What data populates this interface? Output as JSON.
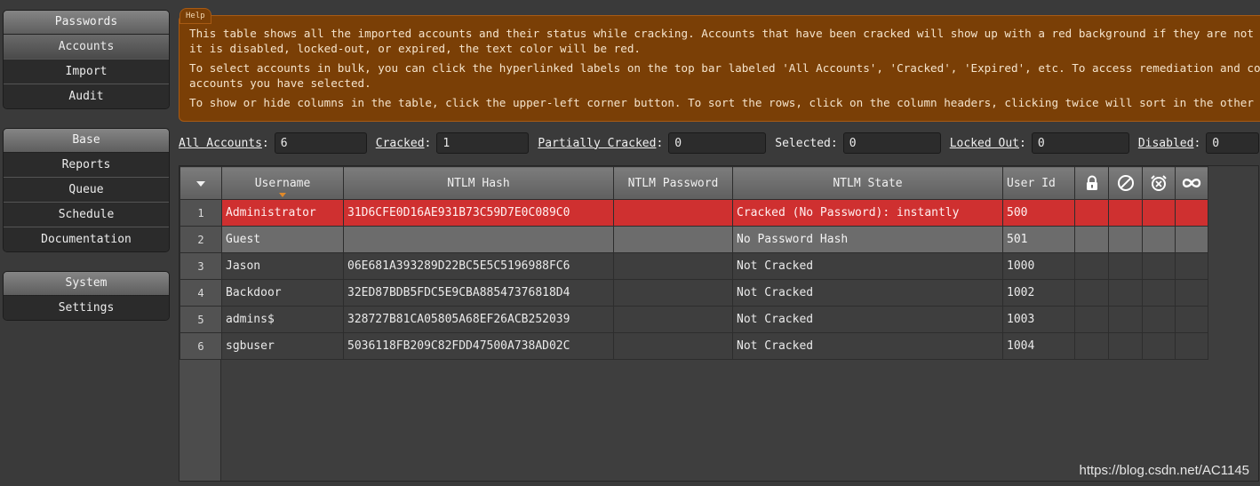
{
  "sidebar": {
    "groups": [
      {
        "header": "Passwords",
        "items": [
          "Accounts",
          "Import",
          "Audit"
        ]
      },
      {
        "header": "Base",
        "items": [
          "Reports",
          "Queue",
          "Schedule",
          "Documentation"
        ]
      },
      {
        "header": "System",
        "items": [
          "Settings"
        ]
      }
    ],
    "selected": "Accounts"
  },
  "help": {
    "tab": "Help",
    "line1": "This table shows all the imported accounts and their status while cracking. Accounts that have been cracked will show up with a red background if they are not lo",
    "line2": "it is disabled, locked-out, or expired, the text color will be red.",
    "line3": "To select accounts in bulk, you can click the hyperlinked labels on the top bar labeled 'All Accounts', 'Cracked', 'Expired', etc. To access remediation and copy",
    "line4": "accounts you have selected.",
    "line5": "To show or hide columns in the table, click the upper-left corner button. To sort the rows, click on the column headers, clicking twice will sort in the other di"
  },
  "filters": {
    "all_accounts": {
      "label": "All Accounts",
      "value": "6"
    },
    "cracked": {
      "label": "Cracked",
      "value": "1"
    },
    "partially_cracked": {
      "label": "Partially Cracked",
      "value": "0"
    },
    "selected": {
      "label": "Selected",
      "value": "0"
    },
    "locked_out": {
      "label": "Locked Out",
      "value": "0"
    },
    "disabled": {
      "label": "Disabled",
      "value": "0"
    }
  },
  "table": {
    "columns": {
      "username": "Username",
      "ntlm_hash": "NTLM Hash",
      "ntlm_password": "NTLM Password",
      "ntlm_state": "NTLM State",
      "user_id": "User Id"
    },
    "icon_columns": [
      "lock-icon",
      "disabled-icon",
      "expired-alarm-icon",
      "never-expire-icon"
    ],
    "rows": [
      {
        "num": "1",
        "username": "Administrator",
        "hash": "31D6CFE0D16AE931B73C59D7E0C089C0",
        "password": "",
        "state": "Cracked (No Password): instantly",
        "uid": "500",
        "style": "cracked"
      },
      {
        "num": "2",
        "username": "Guest",
        "hash": "",
        "password": "",
        "state": "No Password Hash",
        "uid": "501",
        "style": "nohash"
      },
      {
        "num": "3",
        "username": "Jason",
        "hash": "06E681A393289D22BC5E5C5196988FC6",
        "password": "",
        "state": "Not Cracked",
        "uid": "1000",
        "style": "normal"
      },
      {
        "num": "4",
        "username": "Backdoor",
        "hash": "32ED87BDB5FDC5E9CBA88547376818D4",
        "password": "",
        "state": "Not Cracked",
        "uid": "1002",
        "style": "normal"
      },
      {
        "num": "5",
        "username": "admins$",
        "hash": "328727B81CA05805A68EF26ACB252039",
        "password": "",
        "state": "Not Cracked",
        "uid": "1003",
        "style": "normal"
      },
      {
        "num": "6",
        "username": "sgbuser",
        "hash": "5036118FB209C82FDD47500A738AD02C",
        "password": "",
        "state": "Not Cracked",
        "uid": "1004",
        "style": "normal"
      }
    ]
  },
  "watermark": "https://blog.csdn.net/AC1145",
  "colors": {
    "cracked_row": "#cf3030",
    "nohash_row": "#6c6c6c",
    "help_bg": "#7a3f06",
    "sort_caret": "#e08a2a"
  }
}
